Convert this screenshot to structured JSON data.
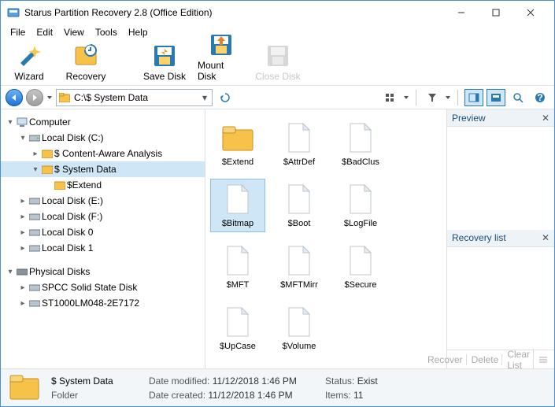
{
  "window": {
    "title": "Starus Partition Recovery 2.8 (Office Edition)"
  },
  "menu": {
    "file": "File",
    "edit": "Edit",
    "view": "View",
    "tools": "Tools",
    "help": "Help"
  },
  "toolbar": {
    "wizard": "Wizard",
    "recovery": "Recovery",
    "save_disk": "Save Disk",
    "mount_disk": "Mount Disk",
    "close_disk": "Close Disk"
  },
  "address": {
    "path": "C:\\$ System Data"
  },
  "tree": {
    "computer": "Computer",
    "local_c": "Local Disk (C:)",
    "content_aware": "$ Content-Aware Analysis",
    "system_data": "$ System Data",
    "extend": "$Extend",
    "local_e": "Local Disk (E:)",
    "local_f": "Local Disk (F:)",
    "local_0": "Local Disk 0",
    "local_1": "Local Disk 1",
    "physical": "Physical Disks",
    "spcc": "SPCC Solid State Disk",
    "st1000": "ST1000LM048-2E7172"
  },
  "files": {
    "r1": [
      "$Extend",
      "$AttrDef",
      "$BadClus"
    ],
    "r2": [
      "$Bitmap",
      "$Boot",
      "$LogFile"
    ],
    "r3": [
      "$MFT",
      "$MFTMirr",
      "$Secure"
    ],
    "r4": [
      "$UpCase",
      "$Volume"
    ]
  },
  "panels": {
    "preview": "Preview",
    "recovery_list": "Recovery list"
  },
  "rl_actions": {
    "recover": "Recover",
    "delete": "Delete",
    "clear": "Clear List"
  },
  "status": {
    "name": "$ System Data",
    "type": "Folder",
    "modified_lbl": "Date modified:",
    "modified_val": "11/12/2018 1:46 PM",
    "created_lbl": "Date created:",
    "created_val": "11/12/2018 1:46 PM",
    "status_lbl": "Status:",
    "status_val": "Exist",
    "items_lbl": "Items:",
    "items_val": "11"
  }
}
